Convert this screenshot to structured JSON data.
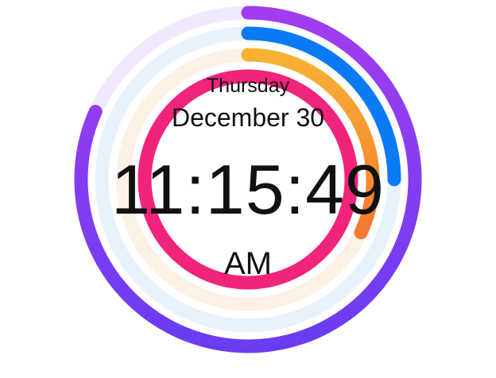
{
  "clock": {
    "day_of_week": "Thursday",
    "date": "December 30",
    "time": "11:15:49",
    "meridiem": "AM"
  },
  "rings": [
    {
      "name": "seconds",
      "fraction": 0.8167,
      "color_start": "#a23cf0",
      "color_end": "#6a3cf0",
      "track_color": "#f1e8fd"
    },
    {
      "name": "minutes",
      "fraction": 0.25,
      "color_start": "#0a7af5",
      "color_end": "#0a7af5",
      "track_color": "#e8f2fd"
    },
    {
      "name": "hours",
      "fraction": 0.32,
      "color_start": "#f7b233",
      "color_end": "#f5782f",
      "track_color": "#fdf0e4"
    },
    {
      "name": "days",
      "fraction": 1.0,
      "color_start": "#f0247a",
      "color_end": "#f0247a",
      "track_color": "#fde6ef"
    }
  ],
  "colors": {
    "background": "#ffffff",
    "text": "#111111"
  }
}
